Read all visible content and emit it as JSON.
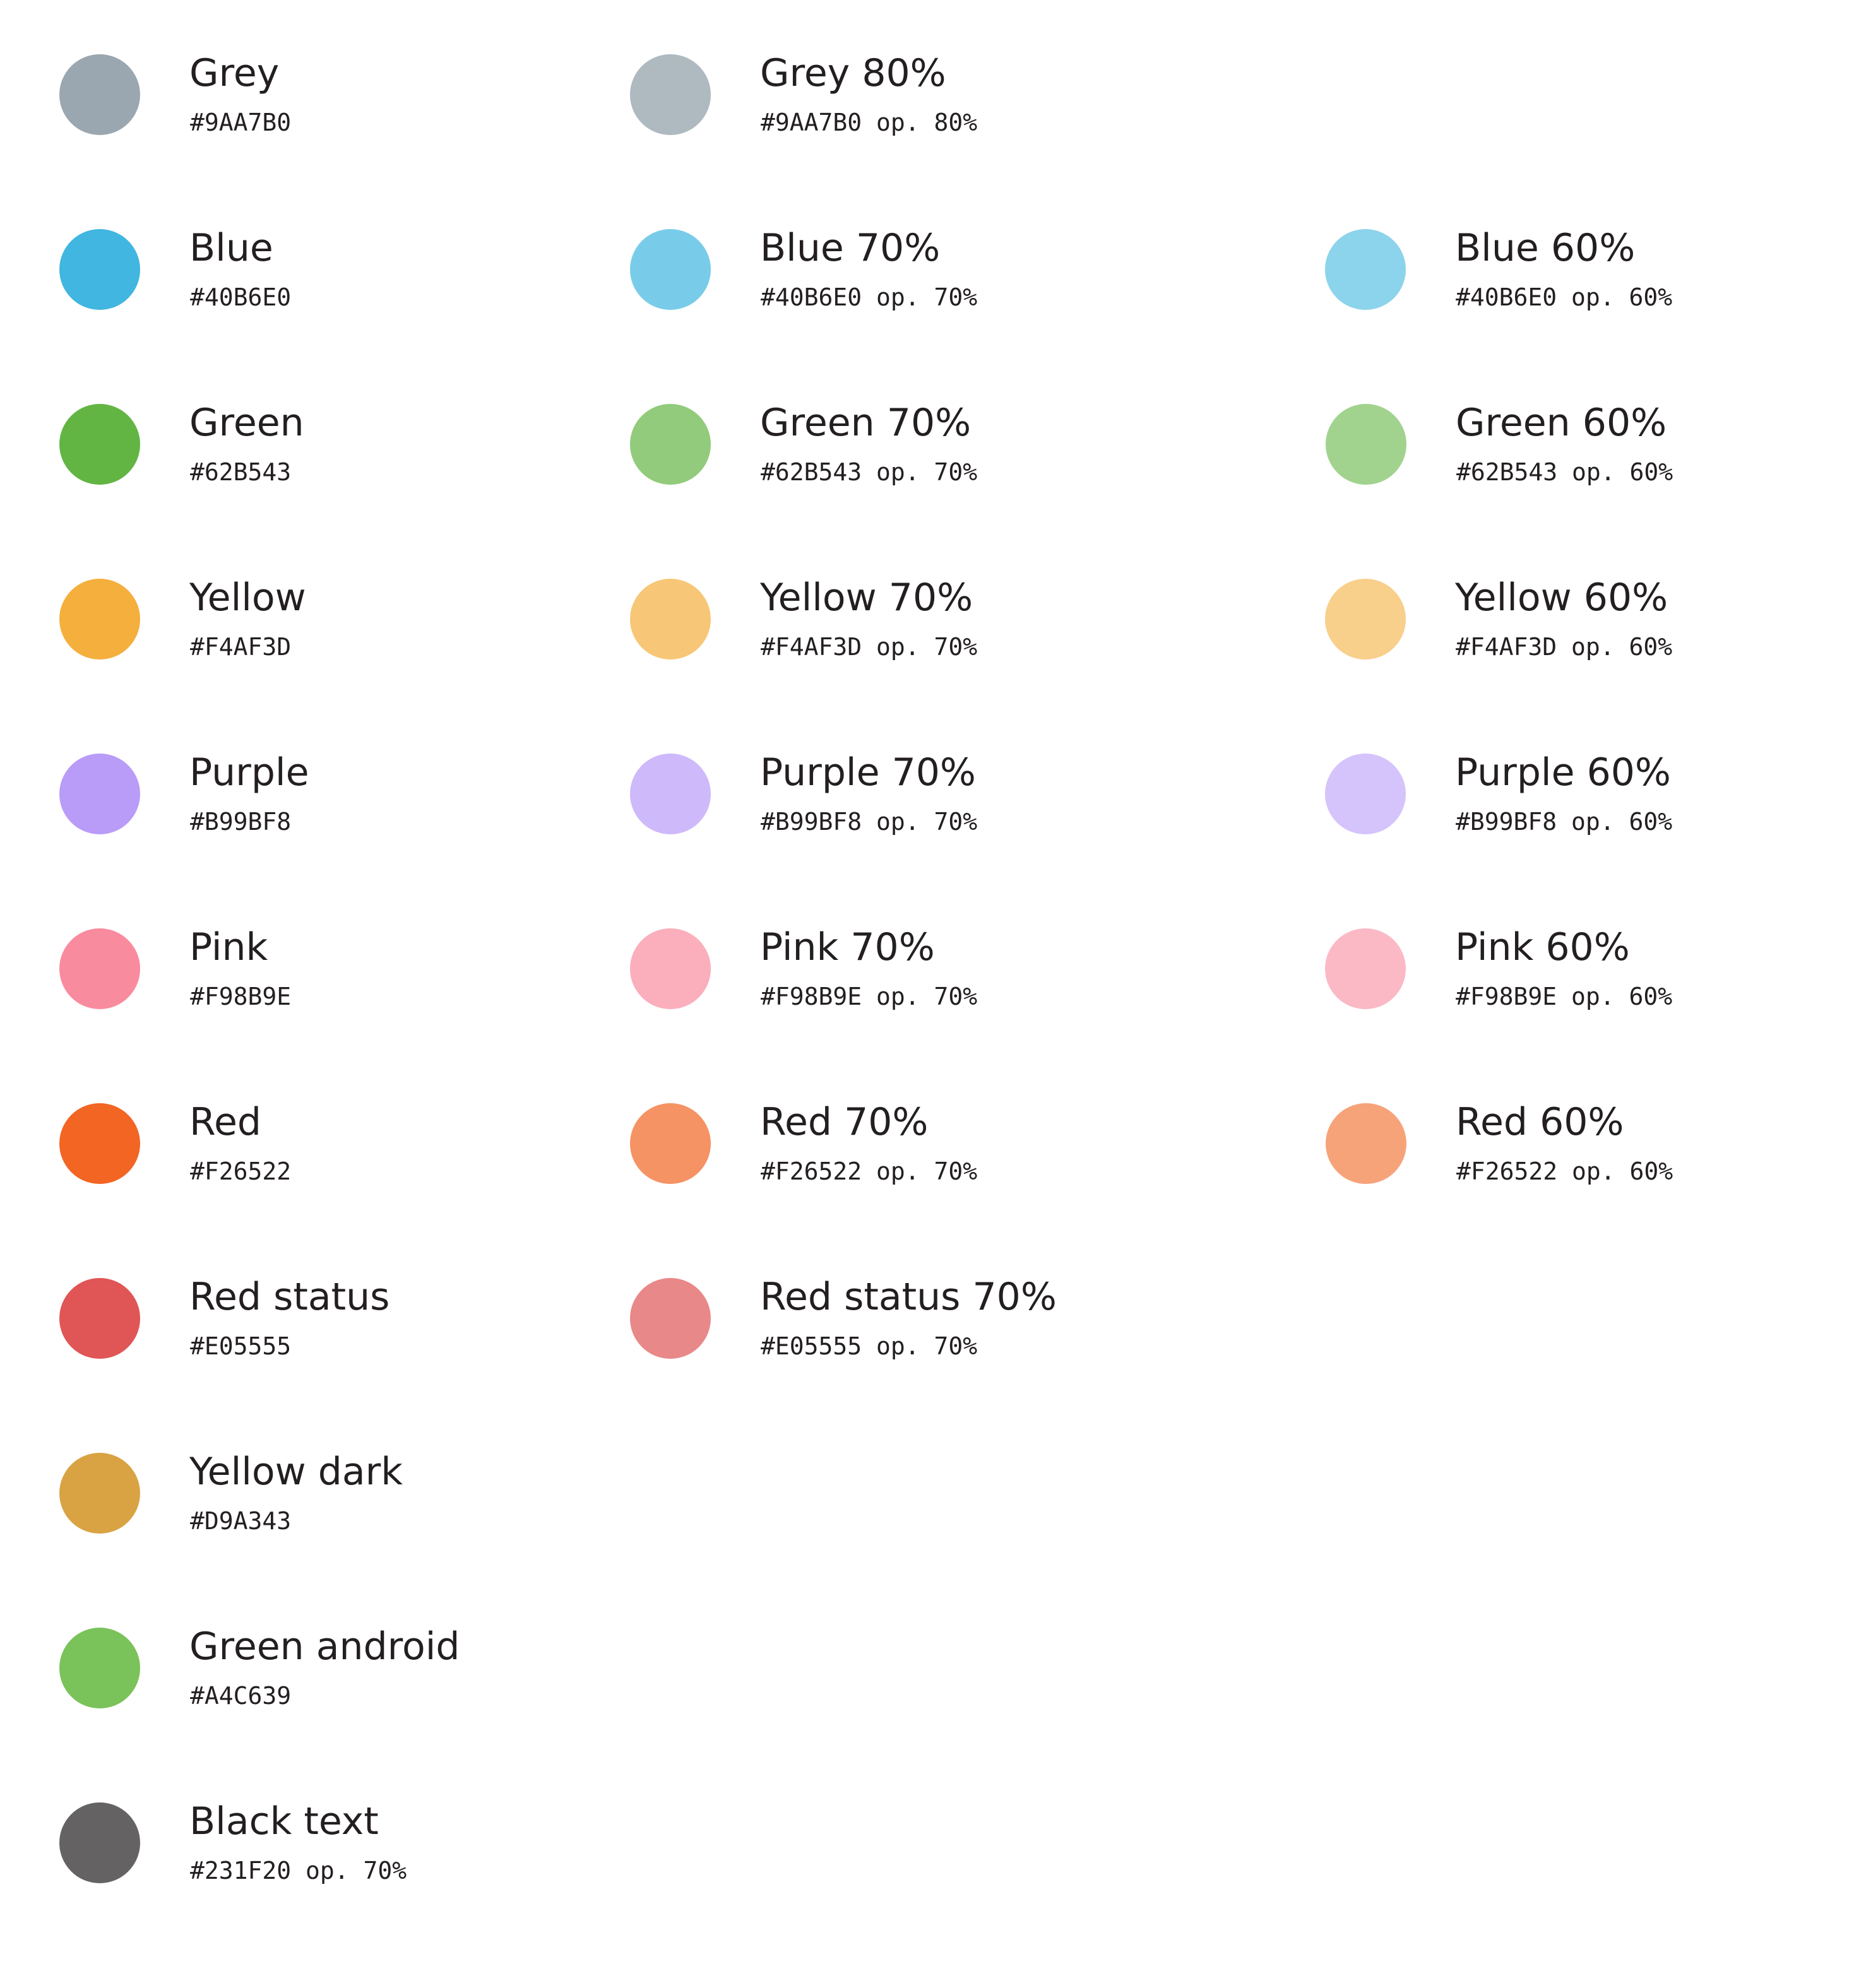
{
  "palette": {
    "colors": [
      {
        "name": "Grey",
        "code": "#9AA7B0",
        "swatch": "#9AA7B0"
      },
      {
        "name": "Grey 80%",
        "code": "#9AA7B0 op. 80%",
        "swatch": "#AEB9C0"
      },
      {
        "name": "Blue",
        "code": "#40B6E0",
        "swatch": "#40B6E0"
      },
      {
        "name": "Blue 70%",
        "code": "#40B6E0 op. 70%",
        "swatch": "#79CCE9"
      },
      {
        "name": "Blue 60%",
        "code": "#40B6E0 op. 60%",
        "swatch": "#8CD3EC"
      },
      {
        "name": "Green",
        "code": "#62B543",
        "swatch": "#62B543"
      },
      {
        "name": "Green 70%",
        "code": "#62B543 op. 70%",
        "swatch": "#91CB7B"
      },
      {
        "name": "Green 60%",
        "code": "#62B543 op. 60%",
        "swatch": "#A1D38E"
      },
      {
        "name": "Yellow",
        "code": "#F4AF3D",
        "swatch": "#F4AF3D"
      },
      {
        "name": "Yellow 70%",
        "code": "#F4AF3D op. 70%",
        "swatch": "#F7C777"
      },
      {
        "name": "Yellow 60%",
        "code": "#F4AF3D op. 60%",
        "swatch": "#F8CF8B"
      },
      {
        "name": "Purple",
        "code": "#B99BF8",
        "swatch": "#B99BF8"
      },
      {
        "name": "Purple 70%",
        "code": "#B99BF8 op. 70%",
        "swatch": "#CEB9FA"
      },
      {
        "name": "Purple 60%",
        "code": "#B99BF8 op. 60%",
        "swatch": "#D5C3FB"
      },
      {
        "name": "Pink",
        "code": "#F98B9E",
        "swatch": "#F98B9E"
      },
      {
        "name": "Pink 70%",
        "code": "#F98B9E op. 70%",
        "swatch": "#FBAEBB"
      },
      {
        "name": "Pink 60%",
        "code": "#F98B9E op. 60%",
        "swatch": "#FBB9C5"
      },
      {
        "name": "Red",
        "code": "#F26522",
        "swatch": "#F26522"
      },
      {
        "name": "Red 70%",
        "code": "#F26522 op. 70%",
        "swatch": "#F59364"
      },
      {
        "name": "Red 60%",
        "code": "#F26522 op. 60%",
        "swatch": "#F7A37A"
      },
      {
        "name": "Red status",
        "code": "#E05555",
        "swatch": "#E05555"
      },
      {
        "name": "Red status 70%",
        "code": "#E05555 op. 70%",
        "swatch": "#E98888"
      },
      {
        "name": "Yellow dark",
        "code": "#D9A343",
        "swatch": "#D9A343"
      },
      {
        "name": "Green android",
        "code": "#A4C639",
        "swatch": "#7AC25A"
      },
      {
        "name": "Black text",
        "code": "#231F20 op. 70%",
        "swatch": "#656263"
      }
    ]
  }
}
